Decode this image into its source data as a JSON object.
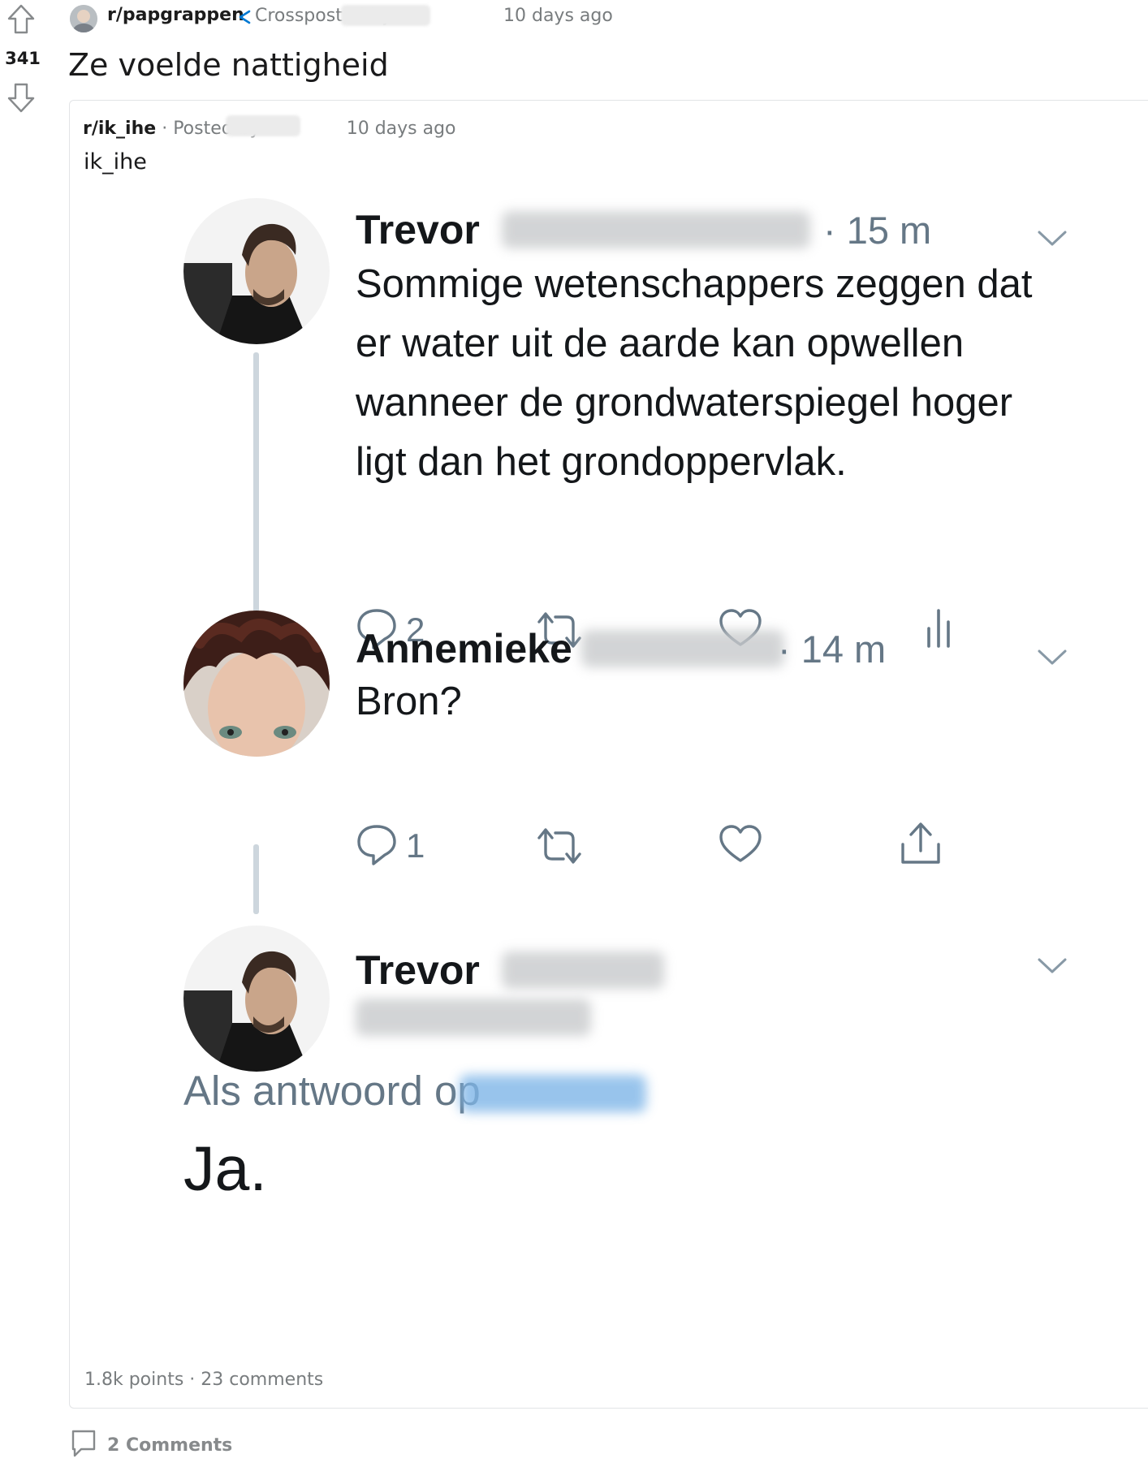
{
  "post": {
    "score": "341",
    "subreddit": "r/papgrappen",
    "crosspost_label": "Crossposted by",
    "time": "10 days ago",
    "title": "Ze voelde nattigheid",
    "comments_label": "2 Comments"
  },
  "crosspost": {
    "subreddit": "r/ik_ihe",
    "separator": "·",
    "posted_by_label": "Posted by",
    "time": "10 days ago",
    "text": "ik_ihe",
    "stats": "1.8k points · 23 comments"
  },
  "tweets": [
    {
      "name": "Trevor",
      "time": "· 15 m",
      "text": "Sommige wetenschappers zeggen dat er water uit de aarde kan opwellen wanneer de grondwaterspiegel hoger ligt dan het grondoppervlak.",
      "replies": "2"
    },
    {
      "name": "Annemieke",
      "time": "· 14 m",
      "text": "Bron?",
      "replies": "1"
    },
    {
      "name": "Trevor",
      "reply_to_label": "Als antwoord op",
      "text": "Ja."
    }
  ],
  "colors": {
    "meta_gray": "#787c7e",
    "twitter_gray": "#657786",
    "twitter_text": "#14171a",
    "crosspost_icon": "#0079d3"
  },
  "icons": [
    "upvote-icon",
    "downvote-icon",
    "crosspost-icon",
    "reply-icon",
    "retweet-icon",
    "like-icon",
    "analytics-icon",
    "share-icon",
    "chevron-down-icon",
    "comment-icon"
  ]
}
